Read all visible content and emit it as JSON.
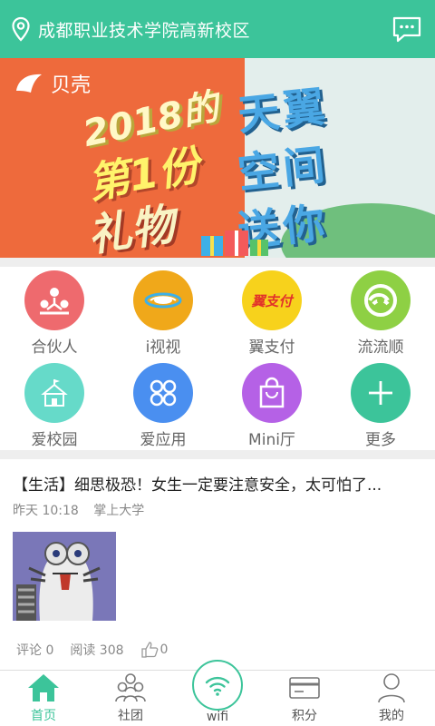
{
  "header": {
    "location": "成都职业技术学院高新校区",
    "location_icon": "location-pin-icon",
    "message_icon": "message-icon"
  },
  "banner": {
    "brand": "贝壳",
    "headline_1": "2018的",
    "headline_2": "第1份",
    "headline_3": "礼物",
    "blue_1": "天翼",
    "blue_2": "空间",
    "blue_3": "送你"
  },
  "grid": {
    "items": [
      {
        "label": "合伙人",
        "icon": "partner-icon",
        "color": "#ee6a6e"
      },
      {
        "label": "i视视",
        "icon": "video-icon",
        "color": "#f0a81a"
      },
      {
        "label": "翼支付",
        "icon": "pay-icon",
        "color": "#f7d21c"
      },
      {
        "label": "流流顺",
        "icon": "flow-icon",
        "color": "#8ed044"
      },
      {
        "label": "爱校园",
        "icon": "campus-icon",
        "color": "#66dac9"
      },
      {
        "label": "爱应用",
        "icon": "apps-icon",
        "color": "#4a8ff0"
      },
      {
        "label": "Mini厅",
        "icon": "shop-bag-icon",
        "color": "#b561e6"
      },
      {
        "label": "更多",
        "icon": "plus-icon",
        "color": "#3cc49a"
      }
    ],
    "pay_badge": "翼支付"
  },
  "article": {
    "title": "【生活】细思极恐！女生一定要注意安全，太可怕了...",
    "time": "昨天 10:18",
    "source": "掌上大学",
    "comments": "评论 0",
    "reads": "阅读 308",
    "likes": "0"
  },
  "nav": {
    "items": [
      {
        "label": "首页",
        "icon": "home-icon",
        "active": true
      },
      {
        "label": "社团",
        "icon": "group-icon",
        "active": false
      },
      {
        "label": "wifi",
        "icon": "wifi-icon",
        "active": false
      },
      {
        "label": "积分",
        "icon": "card-icon",
        "active": false
      },
      {
        "label": "我的",
        "icon": "user-icon",
        "active": false
      }
    ]
  },
  "colors": {
    "brand_green": "#3cc49a",
    "banner_orange": "#ee6a3c"
  }
}
